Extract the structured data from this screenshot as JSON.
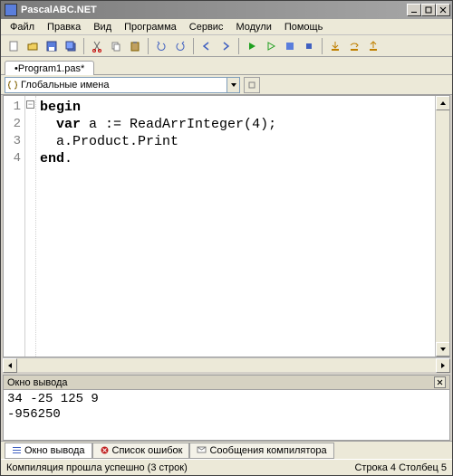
{
  "window": {
    "title": "PascalABC.NET"
  },
  "menu": {
    "items": [
      "Файл",
      "Правка",
      "Вид",
      "Программа",
      "Сервис",
      "Модули",
      "Помощь"
    ]
  },
  "file_tab": {
    "label": "•Program1.pas*"
  },
  "combo": {
    "text": "Глобальные имена"
  },
  "code": {
    "lines": [
      {
        "n": "1",
        "seg": [
          {
            "t": "begin",
            "k": true
          }
        ]
      },
      {
        "n": "2",
        "seg": [
          {
            "t": "  "
          },
          {
            "t": "var",
            "k": true
          },
          {
            "t": " a := ReadArrInteger("
          },
          {
            "t": "4",
            "n": true
          },
          {
            "t": ");"
          }
        ]
      },
      {
        "n": "3",
        "seg": [
          {
            "t": "  a.Product.Print"
          }
        ]
      },
      {
        "n": "4",
        "seg": [
          {
            "t": "end",
            "k": true
          },
          {
            "t": "."
          }
        ]
      }
    ]
  },
  "output": {
    "title": "Окно вывода",
    "lines": [
      "34 -25 125 9",
      "-956250"
    ]
  },
  "bottom_tabs": {
    "items": [
      {
        "label": "Окно вывода",
        "active": true,
        "icon": "list"
      },
      {
        "label": "Список ошибок",
        "active": false,
        "icon": "error"
      },
      {
        "label": "Сообщения компилятора",
        "active": false,
        "icon": "msg"
      }
    ]
  },
  "status": {
    "left": "Компиляция прошла успешно (3 строк)",
    "right": "Строка  4  Столбец  5"
  }
}
